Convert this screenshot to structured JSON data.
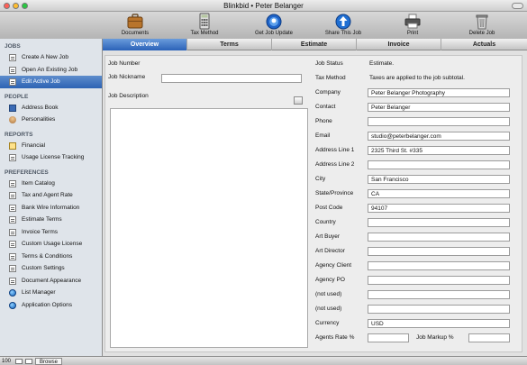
{
  "window": {
    "title": "Blinkbid • Peter Belanger"
  },
  "toolbar": {
    "documents": "Documents",
    "tax_method": "Tax Method",
    "get_job_update": "Get Job Update",
    "share_this_job": "Share This Job",
    "print": "Print",
    "delete_job": "Delete Job"
  },
  "sidebar": {
    "jobs_header": "JOBS",
    "create_new_job": "Create A New Job",
    "open_existing_job": "Open An Existing Job",
    "edit_active_job": "Edit Active Job",
    "people_header": "PEOPLE",
    "address_book": "Address Book",
    "personalities": "Personalities",
    "reports_header": "REPORTS",
    "financial": "Financial",
    "usage_license_tracking": "Usage License Tracking",
    "preferences_header": "PREFERENCES",
    "item_catalog": "Item Catalog",
    "tax_and_agent_rate": "Tax and Agent Rate",
    "bank_wire_information": "Bank Wire Information",
    "estimate_terms": "Estimate Terms",
    "invoice_terms": "Invoice Terms",
    "custom_usage_license": "Custom Usage License",
    "terms_conditions": "Terms & Conditions",
    "custom_settings": "Custom Settings",
    "document_appearance": "Document Appearance",
    "list_manager": "List Manager",
    "application_options": "Application Options"
  },
  "tabs": {
    "overview": "Overview",
    "terms": "Terms",
    "estimate": "Estimate",
    "invoice": "Invoice",
    "actuals": "Actuals"
  },
  "left_form": {
    "job_number_label": "Job Number",
    "job_nickname_label": "Job Nickname",
    "job_nickname_value": "",
    "job_description_label": "Job Description"
  },
  "right_form": {
    "job_status_label": "Job Status",
    "job_status_value": "Estimate.",
    "tax_method_label": "Tax Method",
    "tax_method_value": "Taxes are applied to the job subtotal.",
    "company_label": "Company",
    "company_value": "Peter Belanger Photography",
    "contact_label": "Contact",
    "contact_value": "Peter Belanger",
    "phone_label": "Phone",
    "phone_value": "",
    "email_label": "Email",
    "email_value": "studio@peterbelanger.com",
    "address1_label": "Address Line 1",
    "address1_value": "2325 Third St. #335",
    "address2_label": "Address Line 2",
    "address2_value": "",
    "city_label": "City",
    "city_value": "San Francisco",
    "state_label": "State/Province",
    "state_value": "CA",
    "postcode_label": "Post Code",
    "postcode_value": "94107",
    "country_label": "Country",
    "country_value": "",
    "art_buyer_label": "Art Buyer",
    "art_buyer_value": "",
    "art_director_label": "Art Director",
    "art_director_value": "",
    "agency_client_label": "Agency Client",
    "agency_client_value": "",
    "agency_po_label": "Agency PO",
    "agency_po_value": "",
    "not_used_1_label": "(not used)",
    "not_used_1_value": "",
    "not_used_2_label": "(not used)",
    "not_used_2_value": "",
    "currency_label": "Currency",
    "currency_value": "USD",
    "agents_rate_label": "Agents Rate %",
    "agents_rate_value": "",
    "job_markup_label": "Job Markup %",
    "job_markup_value": ""
  },
  "status_bar": {
    "zoom": "100",
    "view_mode": "Browse"
  }
}
